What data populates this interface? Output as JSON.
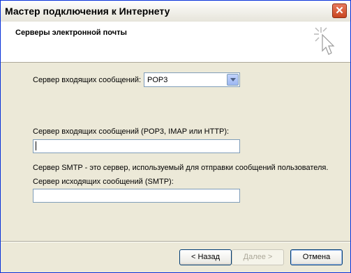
{
  "window": {
    "title": "Мастер подключения к Интернету",
    "close_label": "✕"
  },
  "header": {
    "title": "Серверы электронной почты"
  },
  "form": {
    "incoming_type_label": "Сервер входящих сообщений:",
    "incoming_type_value": "POP3",
    "incoming_server_label": "Сервер входящих сообщений (POP3, IMAP или HTTP):",
    "incoming_server_value": "",
    "smtp_note": "Сервер SMTP - это сервер, используемый для отправки сообщений  пользователя.",
    "outgoing_server_label": "Сервер исходящих сообщений (SMTP):",
    "outgoing_server_value": ""
  },
  "buttons": {
    "back": "< Назад",
    "next": "Далее >",
    "cancel": "Отмена"
  }
}
